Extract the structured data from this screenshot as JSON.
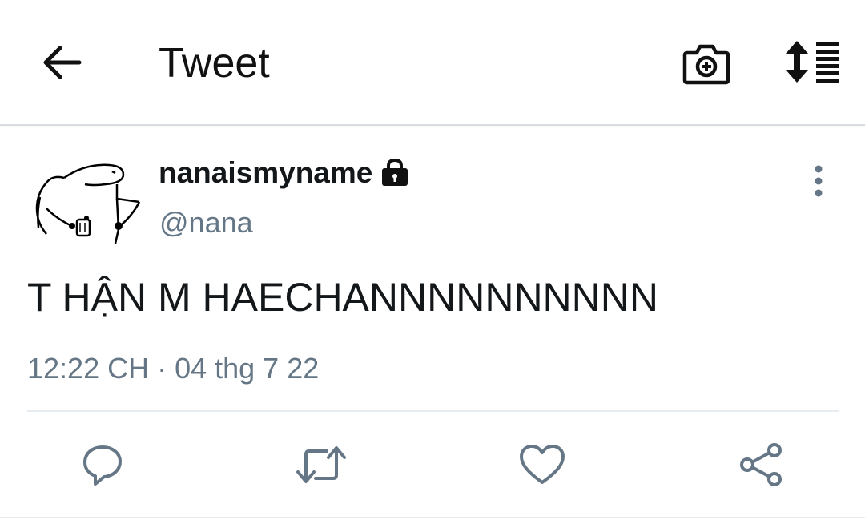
{
  "header": {
    "title": "Tweet",
    "back_icon": "arrow-left-icon",
    "camera_icon": "camera-add-icon",
    "sort_icon": "sort-list-icon"
  },
  "tweet": {
    "display_name": "nanaismyname",
    "protected_icon": "lock-icon",
    "handle": "@nana",
    "text": "T HẬN M HAECHANNNNNNNNNN",
    "time": "12:22 CH",
    "separator": "·",
    "date": "04 thg 7 22",
    "more_icon": "more-vertical-icon"
  },
  "actions": {
    "reply_icon": "reply-icon",
    "retweet_icon": "retweet-icon",
    "like_icon": "heart-icon",
    "share_icon": "share-icon"
  },
  "colors": {
    "text_primary": "#14171a",
    "text_secondary": "#657786",
    "icon_gray": "#657786",
    "divider": "#e6ecf0"
  }
}
